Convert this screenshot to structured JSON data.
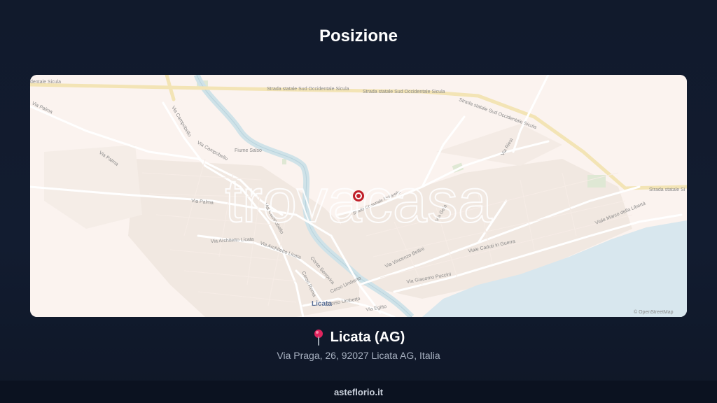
{
  "header": {
    "title": "Posizione"
  },
  "map": {
    "watermark": "trovacasa",
    "attribution": "© OpenStreetMap",
    "places": {
      "town": "Licata"
    },
    "roads": [
      "Strada statale Sud Occidentale Sicula",
      "Strada statale Sud Occidentale Sicula",
      "Strada statale Sud Occidentale Sicula",
      "Strada statale Si",
      "dentale Sicula",
      "Via Palma",
      "Via Palma",
      "Via Palma",
      "Via Campobello",
      "Via Campobello",
      "Via Campobello",
      "Fiume Salso",
      "Via Architetto Licata",
      "Via Architetto Licata",
      "Corso Serrovira",
      "Corso Roma",
      "Corso Umberto",
      "Corso Umberto",
      "Via Vincenzo Bellini",
      "Via Giacomo Puccini",
      "Viale Caduti in Guerra",
      "Viale Marco della Libertà",
      "Via Gela",
      "Via Riesi",
      "Via Egitto",
      "Strada Comunale Mollarella"
    ],
    "marker_color": "#c0202a"
  },
  "location": {
    "pin": "pin-icon",
    "city": "Licata (AG)",
    "address": "Via Praga, 26, 92027 Licata AG, Italia"
  },
  "footer": {
    "site": "asteflorio.it"
  }
}
